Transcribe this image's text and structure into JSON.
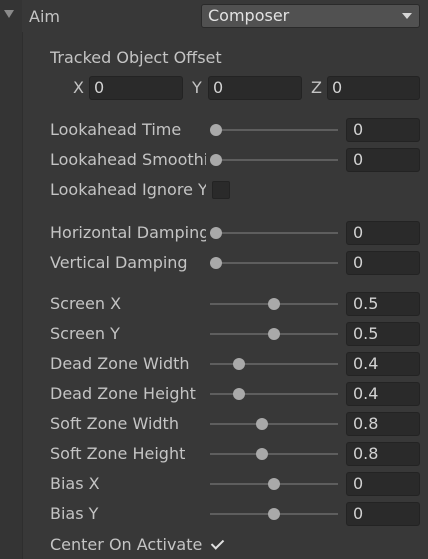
{
  "header": {
    "label": "Aim",
    "dropdown_value": "Composer"
  },
  "tracked_object_offset": {
    "label": "Tracked Object Offset",
    "x_label": "X",
    "x_value": "0",
    "y_label": "Y",
    "y_value": "0",
    "z_label": "Z",
    "z_value": "0"
  },
  "lookahead": {
    "time_label": "Lookahead Time",
    "time_value": "0",
    "time_level": 0,
    "smoothing_label": "Lookahead Smoothing",
    "smoothing_value": "0",
    "smoothing_level": 0,
    "ignore_y_label": "Lookahead Ignore Y",
    "ignore_y_checked": false
  },
  "damping": {
    "horizontal_label": "Horizontal Damping",
    "horizontal_value": "0",
    "horizontal_level": 0,
    "vertical_label": "Vertical Damping",
    "vertical_value": "0",
    "vertical_level": 0
  },
  "composition": {
    "screen_x_label": "Screen X",
    "screen_x_value": "0.5",
    "screen_x_level": 0.5,
    "screen_y_label": "Screen Y",
    "screen_y_value": "0.5",
    "screen_y_level": 0.5,
    "dead_zone_width_label": "Dead Zone Width",
    "dead_zone_width_value": "0.4",
    "dead_zone_width_level": 0.2,
    "dead_zone_height_label": "Dead Zone Height",
    "dead_zone_height_value": "0.4",
    "dead_zone_height_level": 0.2,
    "soft_zone_width_label": "Soft Zone Width",
    "soft_zone_width_value": "0.8",
    "soft_zone_width_level": 0.4,
    "soft_zone_height_label": "Soft Zone Height",
    "soft_zone_height_value": "0.8",
    "soft_zone_height_level": 0.4,
    "bias_x_label": "Bias X",
    "bias_x_value": "0",
    "bias_x_level": 0.5,
    "bias_y_label": "Bias Y",
    "bias_y_value": "0",
    "bias_y_level": 0.5
  },
  "center_on_activate": {
    "label": "Center On Activate",
    "checked": true
  }
}
